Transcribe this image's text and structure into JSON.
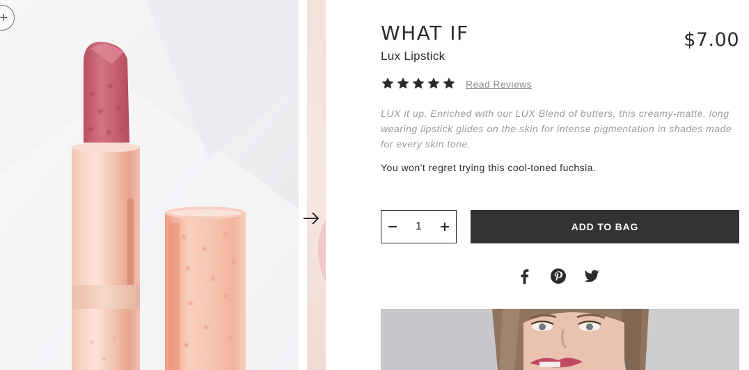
{
  "product": {
    "name": "WHAT IF",
    "type": "Lux Lipstick",
    "price": "$7.00",
    "rating": 5,
    "rating_max": 5,
    "reviews_link": "Read Reviews",
    "description": "LUX it up. Enriched with our LUX Blend of butters, this creamy-matte, long wearing lipstick glides on the skin for intense pigmentation in shades made for every skin tone.",
    "note": "You won't regret trying this cool-toned fuchsia."
  },
  "gallery": {
    "zoom_icon": "plus-icon",
    "next_icon": "arrow-right-icon"
  },
  "cart": {
    "quantity": "1",
    "decrease_icon": "minus-icon",
    "increase_icon": "plus-icon",
    "add_label": "ADD TO BAG"
  },
  "share": {
    "icons": [
      "facebook-icon",
      "pinterest-icon",
      "twitter-icon"
    ]
  },
  "colors": {
    "text": "#2b2b2b",
    "muted": "#9a9a9a",
    "button_bg": "#333333",
    "button_text": "#ffffff",
    "lipstick_shade": "#c96675",
    "tube_rose_gold": "#f1c4b4"
  }
}
